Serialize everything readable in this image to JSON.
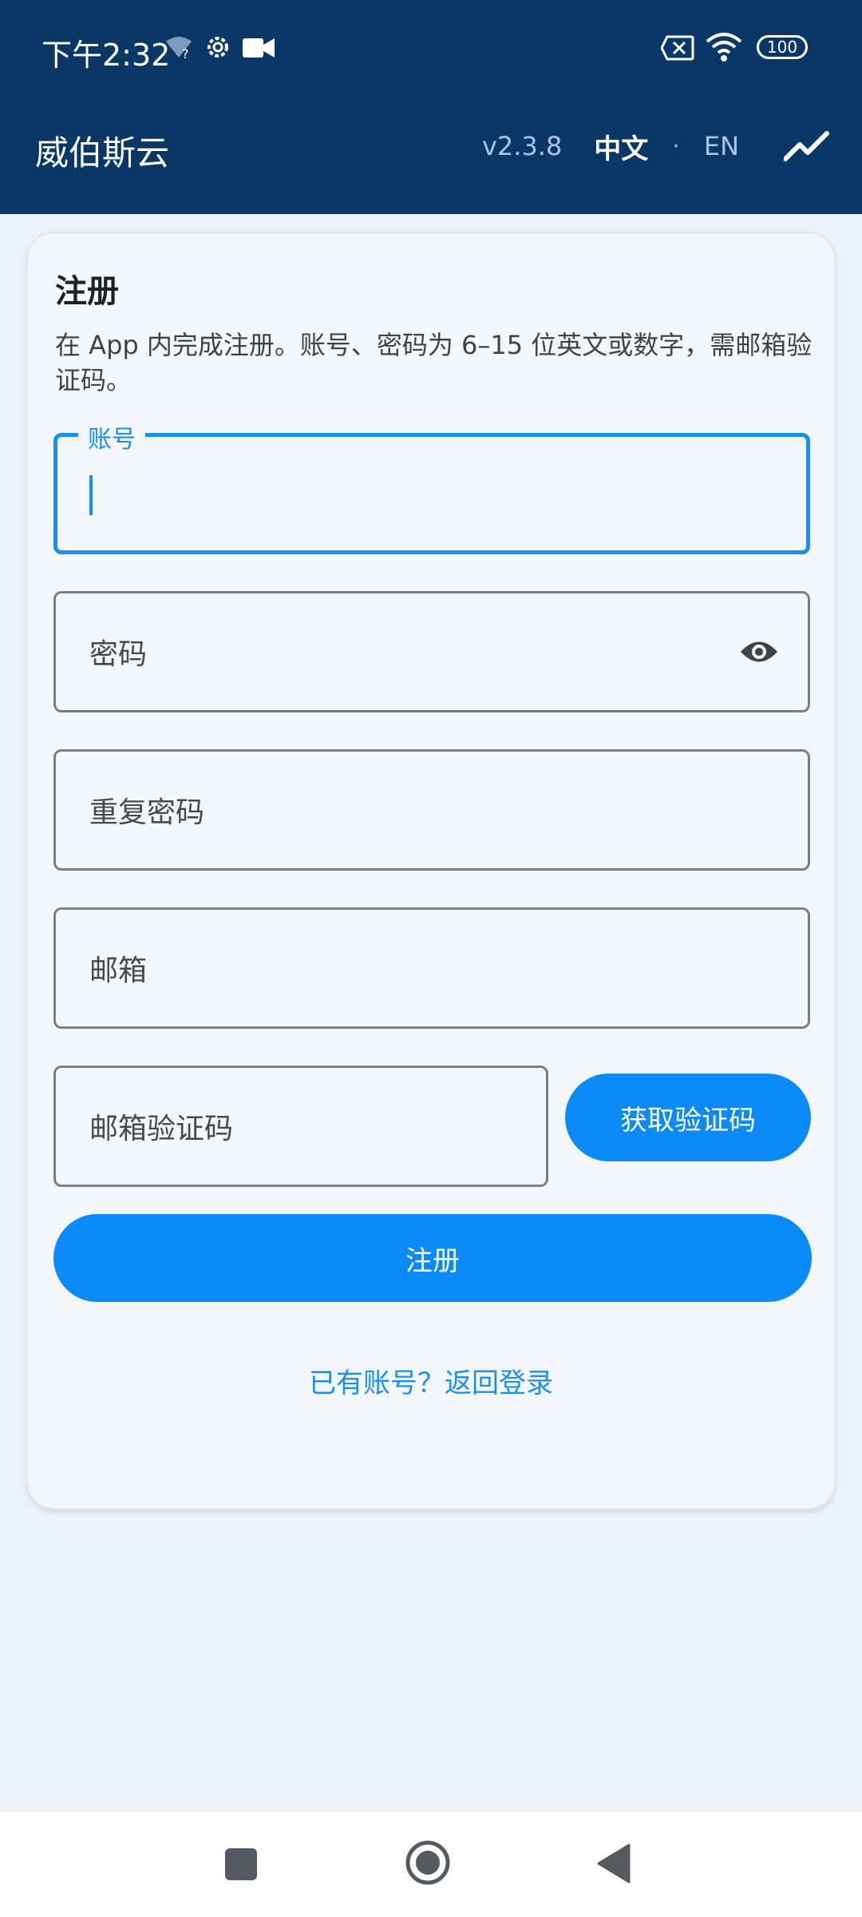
{
  "status_bar": {
    "time": "下午2:32",
    "icons": [
      "wifi-question-icon",
      "gear-icon",
      "video-camera-icon",
      "sim-off-icon",
      "wifi-icon",
      "battery-icon"
    ],
    "battery": "100"
  },
  "app_bar": {
    "title": "威伯斯云",
    "version": "v2.3.8",
    "lang_zh": "中文",
    "lang_sep": "·",
    "lang_en": "EN",
    "chart_icon": "trending-up-icon"
  },
  "register": {
    "title": "注册",
    "description": "在 App 内完成注册。账号、密码为 6–15 位英文或数字，需邮箱验证码。",
    "fields": {
      "account": {
        "label": "账号",
        "value": ""
      },
      "password": {
        "placeholder": "密码",
        "icon": "eye-icon"
      },
      "repeat_password": {
        "placeholder": "重复密码"
      },
      "email": {
        "placeholder": "邮箱"
      },
      "email_code": {
        "placeholder": "邮箱验证码"
      }
    },
    "get_code_button": "获取验证码",
    "submit_button": "注册",
    "login_link": "已有账号？返回登录"
  },
  "nav_bar": {
    "buttons": [
      "recents-square-icon",
      "home-circle-icon",
      "back-triangle-icon"
    ]
  },
  "colors": {
    "app_bar": "#0b3766",
    "accent": "#0a8bf7",
    "background": "#eef3f9"
  }
}
